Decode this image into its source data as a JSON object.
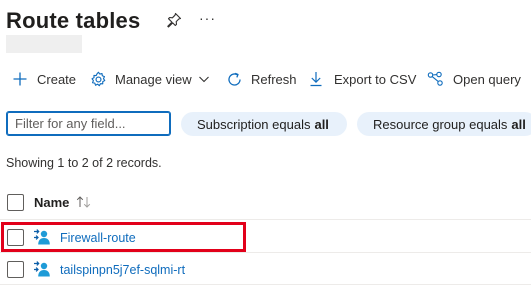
{
  "page": {
    "title": "Route tables",
    "more_glyph": "···"
  },
  "toolbar": {
    "create_label": "Create",
    "manage_view_label": "Manage view",
    "refresh_label": "Refresh",
    "export_label": "Export to CSV",
    "open_query_label": "Open query"
  },
  "filter": {
    "placeholder": "Filter for any field..."
  },
  "pills": {
    "subscription_prefix": "Subscription equals",
    "subscription_value": "all",
    "resource_group_prefix": "Resource group equals",
    "resource_group_value": "all"
  },
  "records_text": "Showing 1 to 2 of 2 records.",
  "table": {
    "columns": [
      "Name"
    ],
    "rows": [
      {
        "name": "Firewall-route",
        "icon": "route-table-icon"
      },
      {
        "name": "tailspinpn5j7ef-sqlmi-rt",
        "icon": "route-table-icon"
      }
    ]
  },
  "colors": {
    "accent": "#0f6cbd",
    "pill_bg": "#e8f1fb",
    "highlight": "#e2001a"
  }
}
